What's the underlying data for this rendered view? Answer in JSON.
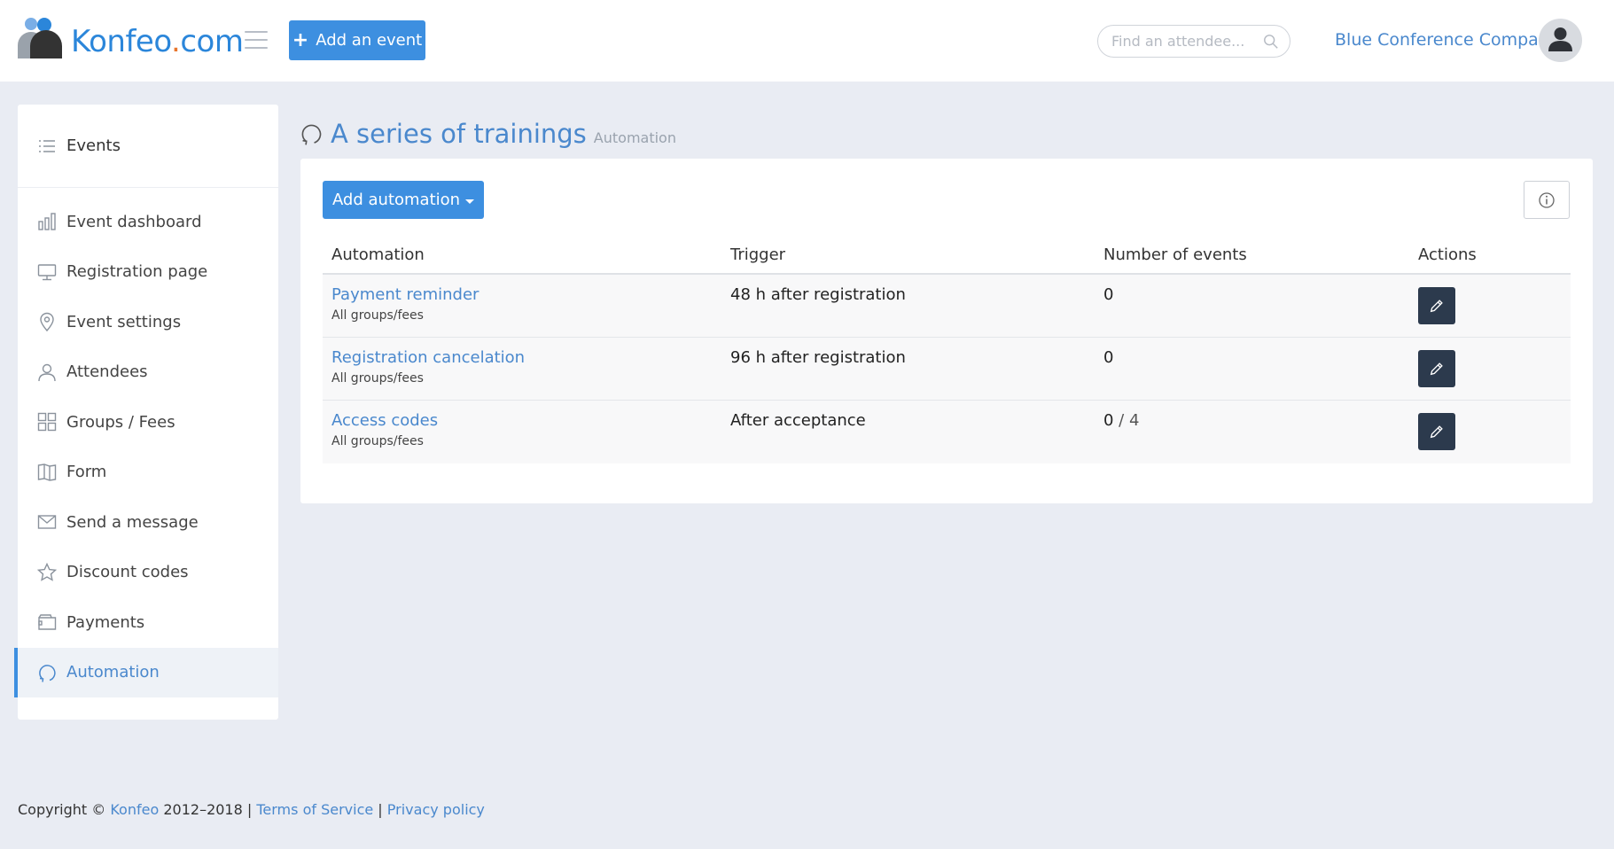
{
  "header": {
    "logo_name": "Konfeo",
    "logo_dot": ".",
    "logo_tld": "com",
    "add_event_label": "Add an event",
    "search_placeholder": "Find an attendee...",
    "company_name": "Blue Conference Company"
  },
  "sidebar": {
    "events_label": "Events",
    "items": [
      {
        "label": "Event dashboard",
        "icon": "bar-chart-icon"
      },
      {
        "label": "Registration page",
        "icon": "monitor-icon"
      },
      {
        "label": "Event settings",
        "icon": "map-pin-icon"
      },
      {
        "label": "Attendees",
        "icon": "user-icon"
      },
      {
        "label": "Groups / Fees",
        "icon": "grid-icon"
      },
      {
        "label": "Form",
        "icon": "book-icon"
      },
      {
        "label": "Send a message",
        "icon": "envelope-icon"
      },
      {
        "label": "Discount codes",
        "icon": "star-icon"
      },
      {
        "label": "Payments",
        "icon": "wallet-icon"
      },
      {
        "label": "Automation",
        "icon": "refresh-icon",
        "active": true
      }
    ]
  },
  "page": {
    "title": "A series of trainings",
    "subtitle": "Automation"
  },
  "panel": {
    "add_automation_label": "Add automation",
    "columns": {
      "automation": "Automation",
      "trigger": "Trigger",
      "number_of_events": "Number of events",
      "actions": "Actions"
    },
    "rows": [
      {
        "name": "Payment reminder",
        "scope": "All groups/fees",
        "trigger": "48 h after registration",
        "count": "0",
        "total": ""
      },
      {
        "name": "Registration cancelation",
        "scope": "All groups/fees",
        "trigger": "96 h after registration",
        "count": "0",
        "total": ""
      },
      {
        "name": "Access codes",
        "scope": "All groups/fees",
        "trigger": "After acceptance",
        "count": "0",
        "total": " / 4"
      }
    ]
  },
  "footer": {
    "copyright_prefix": "Copyright ©",
    "brand": "Konfeo",
    "years": "2012–2018",
    "sep1": "|",
    "terms": "Terms of Service",
    "sep2": "|",
    "privacy": "Privacy policy"
  },
  "colors": {
    "accent": "#3d8fe0",
    "link": "#4a88cd",
    "dark_button": "#2c3a4d",
    "page_bg": "#e9ecf3"
  }
}
